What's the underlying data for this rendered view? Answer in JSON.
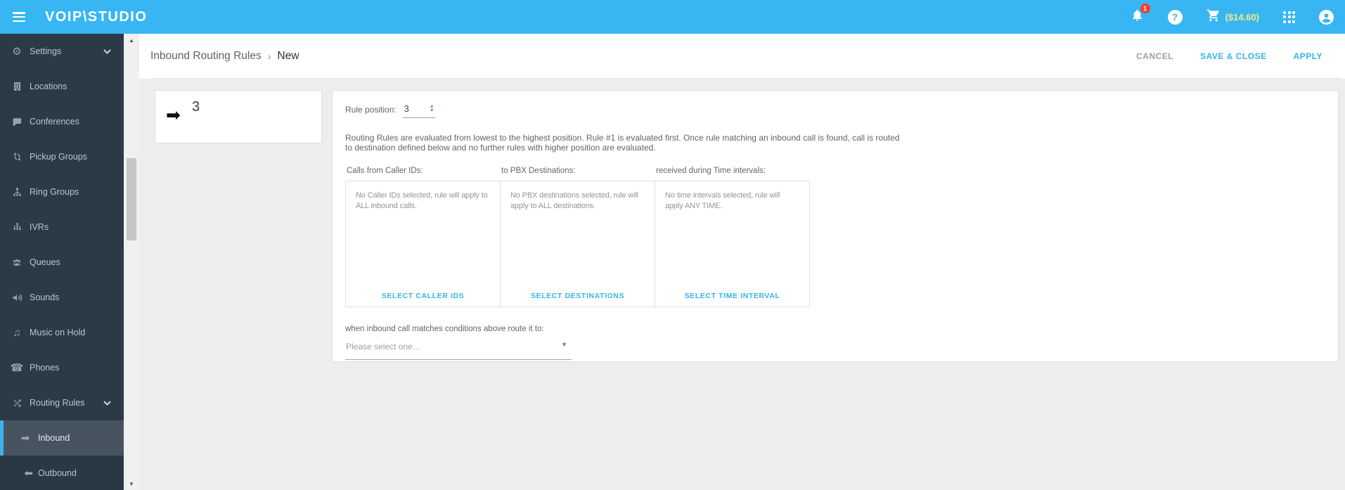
{
  "header": {
    "logo": "VOIP\\STUDIO",
    "notification_count": "1",
    "help_glyph": "?",
    "cart_amount": "($14.60)",
    "colors": {
      "header_blue": "#38b6f3",
      "accent_blue": "#35b3ef",
      "badge_red": "#f43d33",
      "price_yellow": "#f2ea84",
      "sidebar_dark": "#2c3947"
    }
  },
  "sidebar": {
    "items": [
      {
        "label": "Settings"
      },
      {
        "label": "Locations"
      },
      {
        "label": "Conferences"
      },
      {
        "label": "Pickup Groups"
      },
      {
        "label": "Ring Groups"
      },
      {
        "label": "IVRs"
      },
      {
        "label": "Queues"
      },
      {
        "label": "Sounds"
      },
      {
        "label": "Music on Hold"
      },
      {
        "label": "Phones"
      },
      {
        "label": "Routing Rules"
      },
      {
        "label": "Inbound"
      },
      {
        "label": "Outbound"
      }
    ]
  },
  "breadcrumb": {
    "parent": "Inbound Routing Rules",
    "separator": "›",
    "current": "New"
  },
  "actions": {
    "cancel": "CANCEL",
    "save_close": "SAVE & CLOSE",
    "apply": "APPLY"
  },
  "rule_card": {
    "position_value": "3"
  },
  "form": {
    "rule_position_label": "Rule position:",
    "rule_position_value": "3",
    "description_line1": "Routing Rules are evaluated from lowest to the highest position. Rule #1 is evaluated first. Once rule matching an inbound call is found, call is routed",
    "description_line2": "to destination defined below and no further rules with higher position are evaluated.",
    "columns": [
      {
        "label": "Calls from Caller IDs:",
        "hint": "No Caller IDs selected, rule will apply to ALL inbound calls.",
        "action": "SELECT CALLER IDS"
      },
      {
        "label": "to PBX Destinations:",
        "hint": "No PBX destinations selected, rule will apply to ALL destinations.",
        "action": "SELECT DESTINATIONS"
      },
      {
        "label": "received during Time intervals:",
        "hint": "No time intervals selected, rule will apply ANY TIME.",
        "action": "SELECT TIME INTERVAL"
      }
    ],
    "route_label": "when inbound call matches conditions above route it to:",
    "route_placeholder": "Please select one..."
  },
  "icons": {
    "gear": "⚙",
    "music_note": "♫",
    "phone": "☎",
    "arrow_right": "➡",
    "card_arrow": "➡",
    "spin_up": "▲",
    "spin_down": "▼",
    "caret_down": "▼",
    "scroll_up": "▲",
    "scroll_down": "▼"
  }
}
